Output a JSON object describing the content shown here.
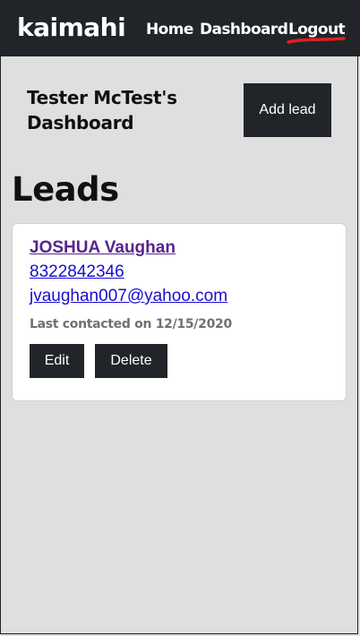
{
  "navbar": {
    "brand": "kaimahi",
    "links": [
      {
        "label": "Home"
      },
      {
        "label": "Dashboard"
      },
      {
        "label": "Logout"
      }
    ],
    "annotation_color": "#e02020"
  },
  "header": {
    "title": "Tester McTest's Dashboard",
    "add_lead_label": "Add lead"
  },
  "leads": {
    "heading": "Leads",
    "items": [
      {
        "name": "JOSHUA Vaughan",
        "phone": "8322842346",
        "email": "jvaughan007@yahoo.com",
        "last_contacted": "Last contacted on 12/15/2020",
        "edit_label": "Edit",
        "delete_label": "Delete"
      }
    ]
  },
  "colors": {
    "navbar_bg": "#212428",
    "page_bg": "#dfdfdf",
    "visited_link": "#58248c",
    "link": "#1a0dcc"
  }
}
